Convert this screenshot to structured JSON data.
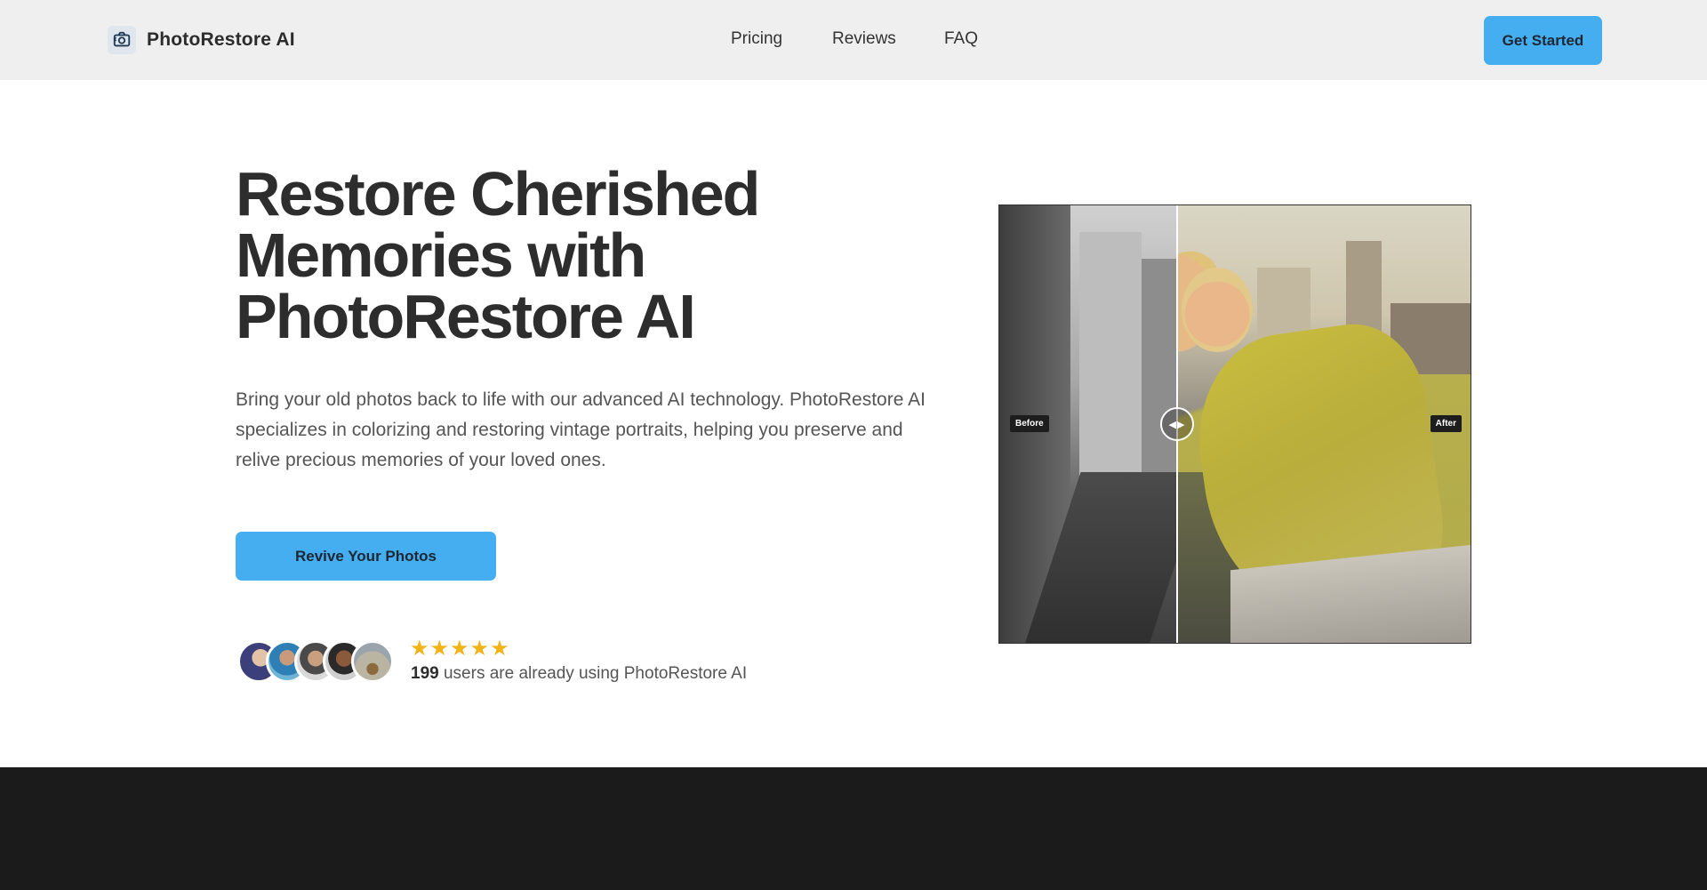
{
  "header": {
    "brand_name": "PhotoRestore AI",
    "logo_icon": "camera-restore-icon",
    "nav": [
      "Pricing",
      "Reviews",
      "FAQ"
    ],
    "cta_label": "Get Started"
  },
  "hero": {
    "title": "Restore Cherished Memories with PhotoRestore AI",
    "description": "Bring your old photos back to life with our advanced AI technology. PhotoRestore AI specializes in colorizing and restoring vintage portraits, helping you preserve and relive precious memories of your loved ones.",
    "cta_label": "Revive Your Photos",
    "rating_stars": 5,
    "users_count": "199",
    "users_text": "users are already using PhotoRestore AI"
  },
  "comparison": {
    "before_label": "Before",
    "after_label": "After",
    "handle_icon": "left-right-arrows-icon"
  },
  "colors": {
    "accent": "#45aef0",
    "star": "#f2b316",
    "header_bg": "#efefef",
    "dark_band": "#1b1b1b"
  }
}
